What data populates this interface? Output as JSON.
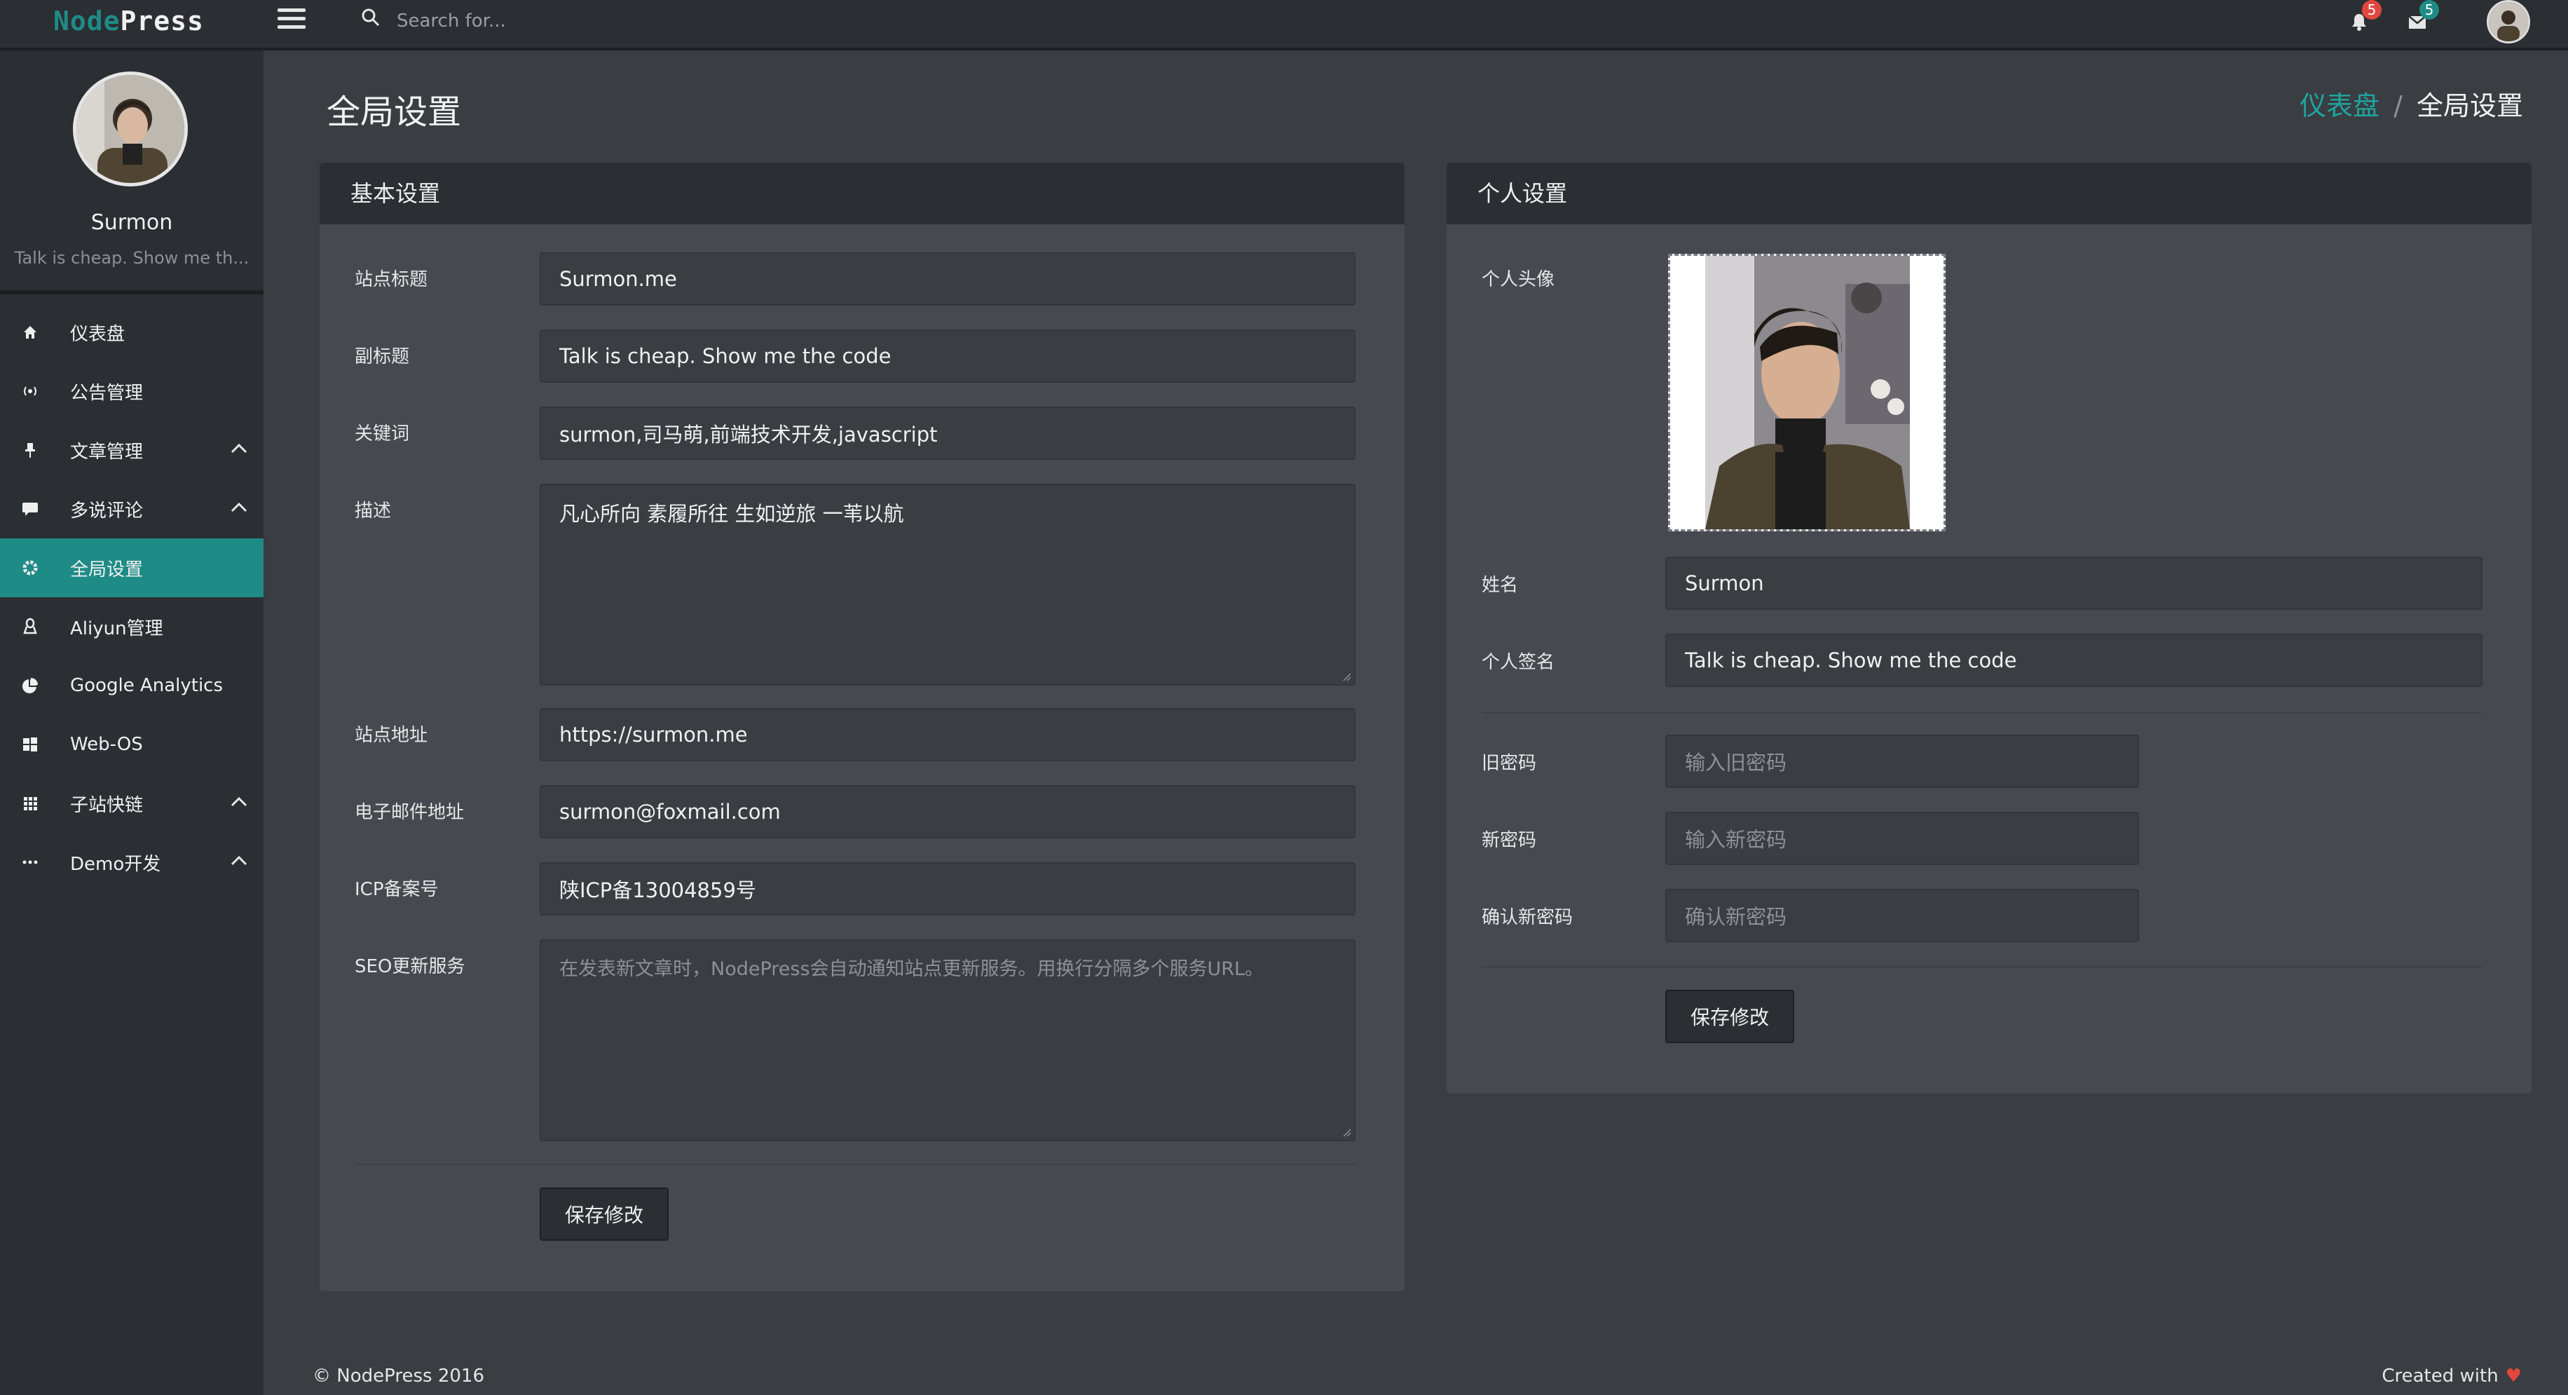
{
  "brand": {
    "part1": "Node",
    "part2": "Press"
  },
  "search": {
    "placeholder": "Search for..."
  },
  "topbar": {
    "notifications_count": "5",
    "messages_count": "5"
  },
  "user": {
    "name": "Surmon",
    "signature": "Talk is cheap. Show me th..."
  },
  "sidebar": {
    "items": [
      {
        "label": "仪表盘",
        "icon": "home-icon"
      },
      {
        "label": "公告管理",
        "icon": "broadcast-icon"
      },
      {
        "label": "文章管理",
        "icon": "pin-icon"
      },
      {
        "label": "多说评论",
        "icon": "comment-icon"
      },
      {
        "label": "全局设置",
        "icon": "gear-icon"
      },
      {
        "label": "Aliyun管理",
        "icon": "linux-icon"
      },
      {
        "label": "Google Analytics",
        "icon": "pie-icon"
      },
      {
        "label": "Web-OS",
        "icon": "windows-icon"
      },
      {
        "label": "子站快链",
        "icon": "grid-icon"
      },
      {
        "label": "Demo开发",
        "icon": "ellipsis-icon"
      }
    ]
  },
  "page": {
    "title": "全局设置"
  },
  "breadcrumb": {
    "link": "仪表盘",
    "separator": "/",
    "current": "全局设置"
  },
  "basic": {
    "title": "基本设置",
    "site_title_label": "站点标题",
    "site_title": "Surmon.me",
    "subtitle_label": "副标题",
    "subtitle": "Talk is cheap. Show me the code",
    "keywords_label": "关键词",
    "keywords": "surmon,司马萌,前端技术开发,javascript",
    "description_label": "描述",
    "description": "凡心所向 素履所往 生如逆旅 一苇以航",
    "url_label": "站点地址",
    "url": "https://surmon.me",
    "email_label": "电子邮件地址",
    "email": "surmon@foxmail.com",
    "icp_label": "ICP备案号",
    "icp": "陕ICP备13004859号",
    "seo_label": "SEO更新服务",
    "seo_placeholder": "在发表新文章时，NodePress会自动通知站点更新服务。用换行分隔多个服务URL。",
    "save": "保存修改"
  },
  "personal": {
    "title": "个人设置",
    "avatar_label": "个人头像",
    "name_label": "姓名",
    "name": "Surmon",
    "sig_label": "个人签名",
    "sig": "Talk is cheap. Show me the code",
    "old_pw_label": "旧密码",
    "old_pw_placeholder": "输入旧密码",
    "new_pw_label": "新密码",
    "new_pw_placeholder": "输入新密码",
    "confirm_pw_label": "确认新密码",
    "confirm_pw_placeholder": "确认新密码",
    "save": "保存修改"
  },
  "footer": {
    "copyright": "© NodePress 2016",
    "created_with": "Created with",
    "heart": "♥"
  },
  "colors": {
    "accent": "#1e8b86",
    "badge_red": "#e2473f",
    "panel": "#464a50",
    "header": "#2b2e33"
  }
}
